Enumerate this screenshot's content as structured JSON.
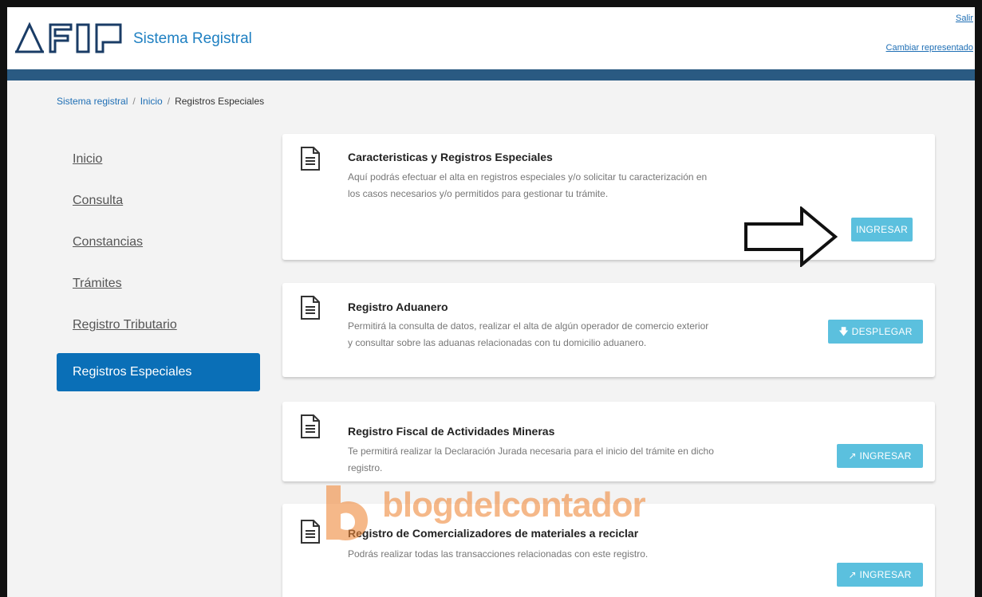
{
  "header": {
    "brand": "Sistema Registral",
    "logout_link": "Salir",
    "change_rep_link": "Cambiar representado"
  },
  "breadcrumb": {
    "items": [
      "Sistema registral",
      "Inicio",
      "Registros Especiales"
    ],
    "separator": "/"
  },
  "sidebar": {
    "items": [
      {
        "label": "Inicio"
      },
      {
        "label": "Consulta"
      },
      {
        "label": "Constancias"
      },
      {
        "label": "Trámites"
      },
      {
        "label": "Registro Tributario"
      },
      {
        "label": "Registros Especiales",
        "active": true
      }
    ]
  },
  "cards": [
    {
      "title": "Caracteristicas y Registros Especiales",
      "desc": "Aquí podrás efectuar el alta en registros especiales y/o solicitar tu caracterización en los casos necesarios y/o permitidos para gestionar tu trámite.",
      "button": "INGRESAR"
    },
    {
      "title": "Registro Aduanero",
      "desc": "Permitirá la consulta de datos, realizar el alta de algún operador de comercio exterior y consultar sobre las aduanas relacionadas con tu domicilio aduanero.",
      "button": "DESPLEGAR",
      "button_icon": "arrow-down-icon"
    },
    {
      "title": "Registro Fiscal de Actividades Mineras",
      "desc": "Te permitirá realizar la Declaración Jurada necesaria para el inicio del trámite en dicho registro.",
      "button": "INGRESAR",
      "button_icon": "external-link-icon"
    },
    {
      "title": "Registro de Comercializadores de materiales a reciclar",
      "desc": "Podrás realizar todas las transacciones relacionadas con este registro.",
      "button": "INGRESAR",
      "button_icon": "external-link-icon"
    }
  ],
  "watermark": "blogdelcontador",
  "colors": {
    "primary": "#0a6fb7",
    "button": "#5bc0de",
    "bar": "#2a5a82",
    "watermark": "#f08a3c"
  }
}
